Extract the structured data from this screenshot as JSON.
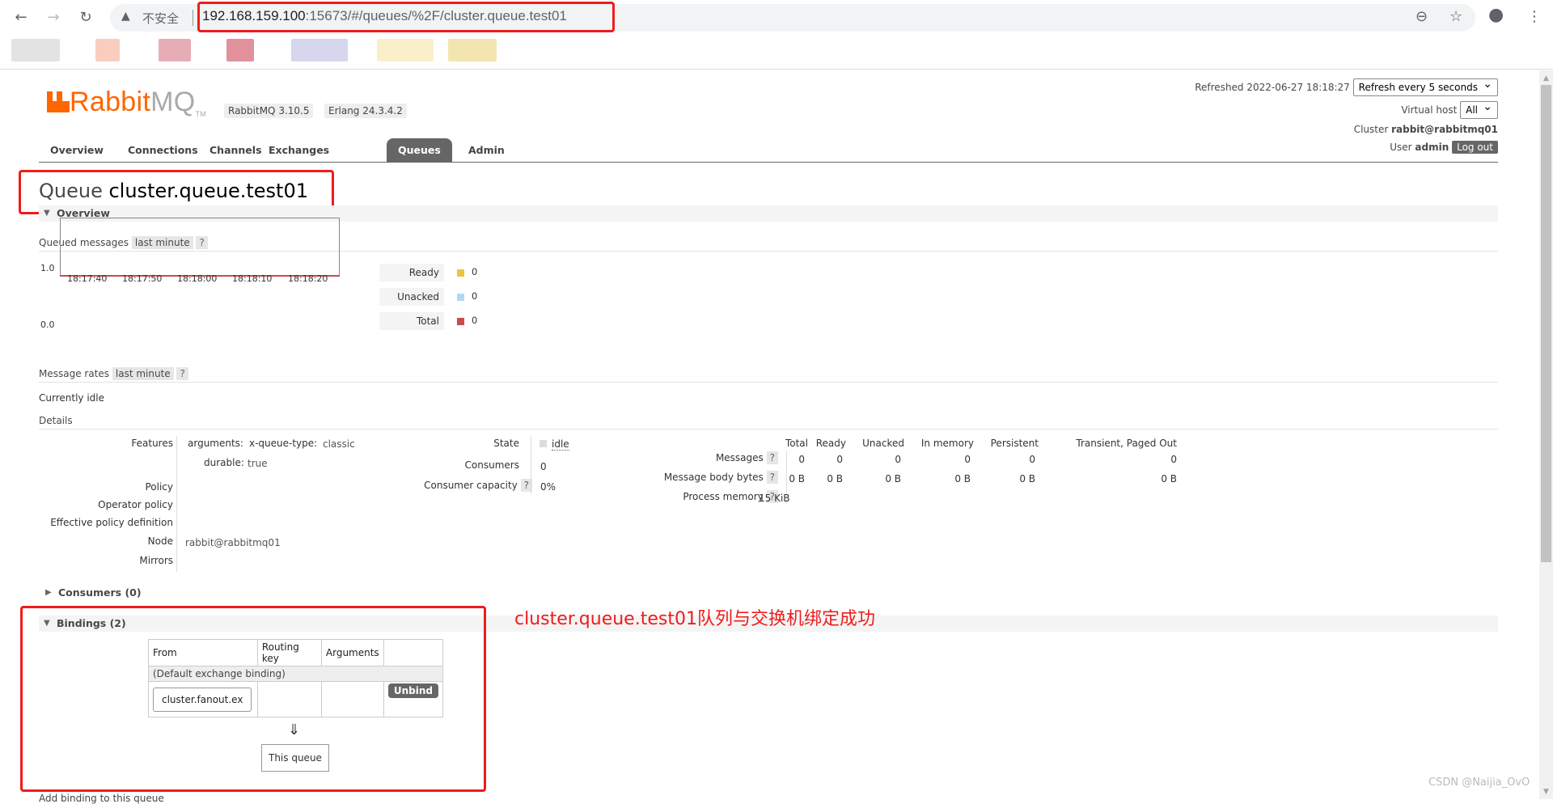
{
  "browser": {
    "back_icon": "arrow-left-icon",
    "forward_icon": "arrow-right-icon",
    "reload_icon": "reload-icon",
    "security_label": "不安全",
    "url_host": "192.168.159.100",
    "url_rest": ":15673/#/queues/%2F/cluster.queue.test01",
    "zoom_icon": "zoom-icon",
    "star_icon": "star-icon",
    "profile_icon": "profile-icon",
    "menu_icon": "kebab-menu-icon"
  },
  "header": {
    "logo_rabbit": "Rabbit",
    "logo_mq": "MQ",
    "logo_tm": "TM",
    "rabbitmq_version": "RabbitMQ 3.10.5",
    "erlang_version": "Erlang 24.3.4.2",
    "refreshed_label": "Refreshed 2022-06-27 18:18:27",
    "refresh_select": "Refresh every 5 seconds",
    "vhost_label": "Virtual host",
    "vhost_select": "All",
    "cluster_label": "Cluster",
    "cluster_name": "rabbit@rabbitmq01",
    "user_label": "User",
    "user_name": "admin",
    "logout": "Log out"
  },
  "tabs": [
    "Overview",
    "Connections",
    "Channels",
    "Exchanges",
    "Queues",
    "Admin"
  ],
  "page": {
    "title_prefix": "Queue",
    "title_name": "cluster.queue.test01",
    "overview_section": "Overview",
    "queued_messages_label": "Queued messages",
    "last_minute": "last minute",
    "help": "?",
    "message_rates_label": "Message rates",
    "currently_idle": "Currently idle",
    "details_label": "Details",
    "consumers_section": "Consumers (0)",
    "bindings_section": "Bindings (2)",
    "add_binding": "Add binding to this queue"
  },
  "chart_data": {
    "type": "line",
    "x": [
      "18:17:40",
      "18:17:50",
      "18:18:00",
      "18:18:10",
      "18:18:20"
    ],
    "ytick_labels": [
      "1.0",
      "0.0"
    ],
    "ylim": [
      0,
      1
    ],
    "series": [
      {
        "name": "Ready",
        "values": [
          0,
          0,
          0,
          0,
          0
        ],
        "color": "#edc240"
      },
      {
        "name": "Unacked",
        "values": [
          0,
          0,
          0,
          0,
          0
        ],
        "color": "#afd8f8"
      },
      {
        "name": "Total",
        "values": [
          0,
          0,
          0,
          0,
          0
        ],
        "color": "#cb4b4b"
      }
    ]
  },
  "legend": [
    {
      "label": "Ready",
      "value": "0",
      "color": "#edc240"
    },
    {
      "label": "Unacked",
      "value": "0",
      "color": "#afd8f8"
    },
    {
      "label": "Total",
      "value": "0",
      "color": "#cb4b4b"
    }
  ],
  "details": {
    "features_label": "Features",
    "arguments_key": "arguments:",
    "x_queue_type_key": "x-queue-type:",
    "x_queue_type_val": "classic",
    "durable_key": "durable:",
    "durable_val": "true",
    "policy_label": "Policy",
    "operator_policy_label": "Operator policy",
    "effective_policy_label": "Effective policy definition",
    "node_label": "Node",
    "node_value": "rabbit@rabbitmq01",
    "mirrors_label": "Mirrors",
    "state_label": "State",
    "state_value": "idle",
    "consumers_label": "Consumers",
    "consumers_value": "0",
    "capacity_label": "Consumer capacity",
    "capacity_value": "0%"
  },
  "stats": {
    "headers": [
      "Total",
      "Ready",
      "Unacked",
      "In memory",
      "Persistent",
      "Transient, Paged Out"
    ],
    "messages_label": "Messages",
    "messages": [
      "0",
      "0",
      "0",
      "0",
      "0",
      "0"
    ],
    "bytes_label": "Message body bytes",
    "bytes": [
      "0 B",
      "0 B",
      "0 B",
      "0 B",
      "0 B",
      "0 B"
    ],
    "process_memory_label": "Process memory",
    "process_memory": "15 KiB"
  },
  "bindings": {
    "headers": [
      "From",
      "Routing key",
      "Arguments"
    ],
    "default_binding": "(Default exchange binding)",
    "exchange": "cluster.fanout.ex",
    "unbind": "Unbind",
    "arrow": "⇓",
    "this_queue": "This queue"
  },
  "annotation": "cluster.queue.test01队列与交换机绑定成功",
  "watermark": "CSDN @Naijia_OvO"
}
